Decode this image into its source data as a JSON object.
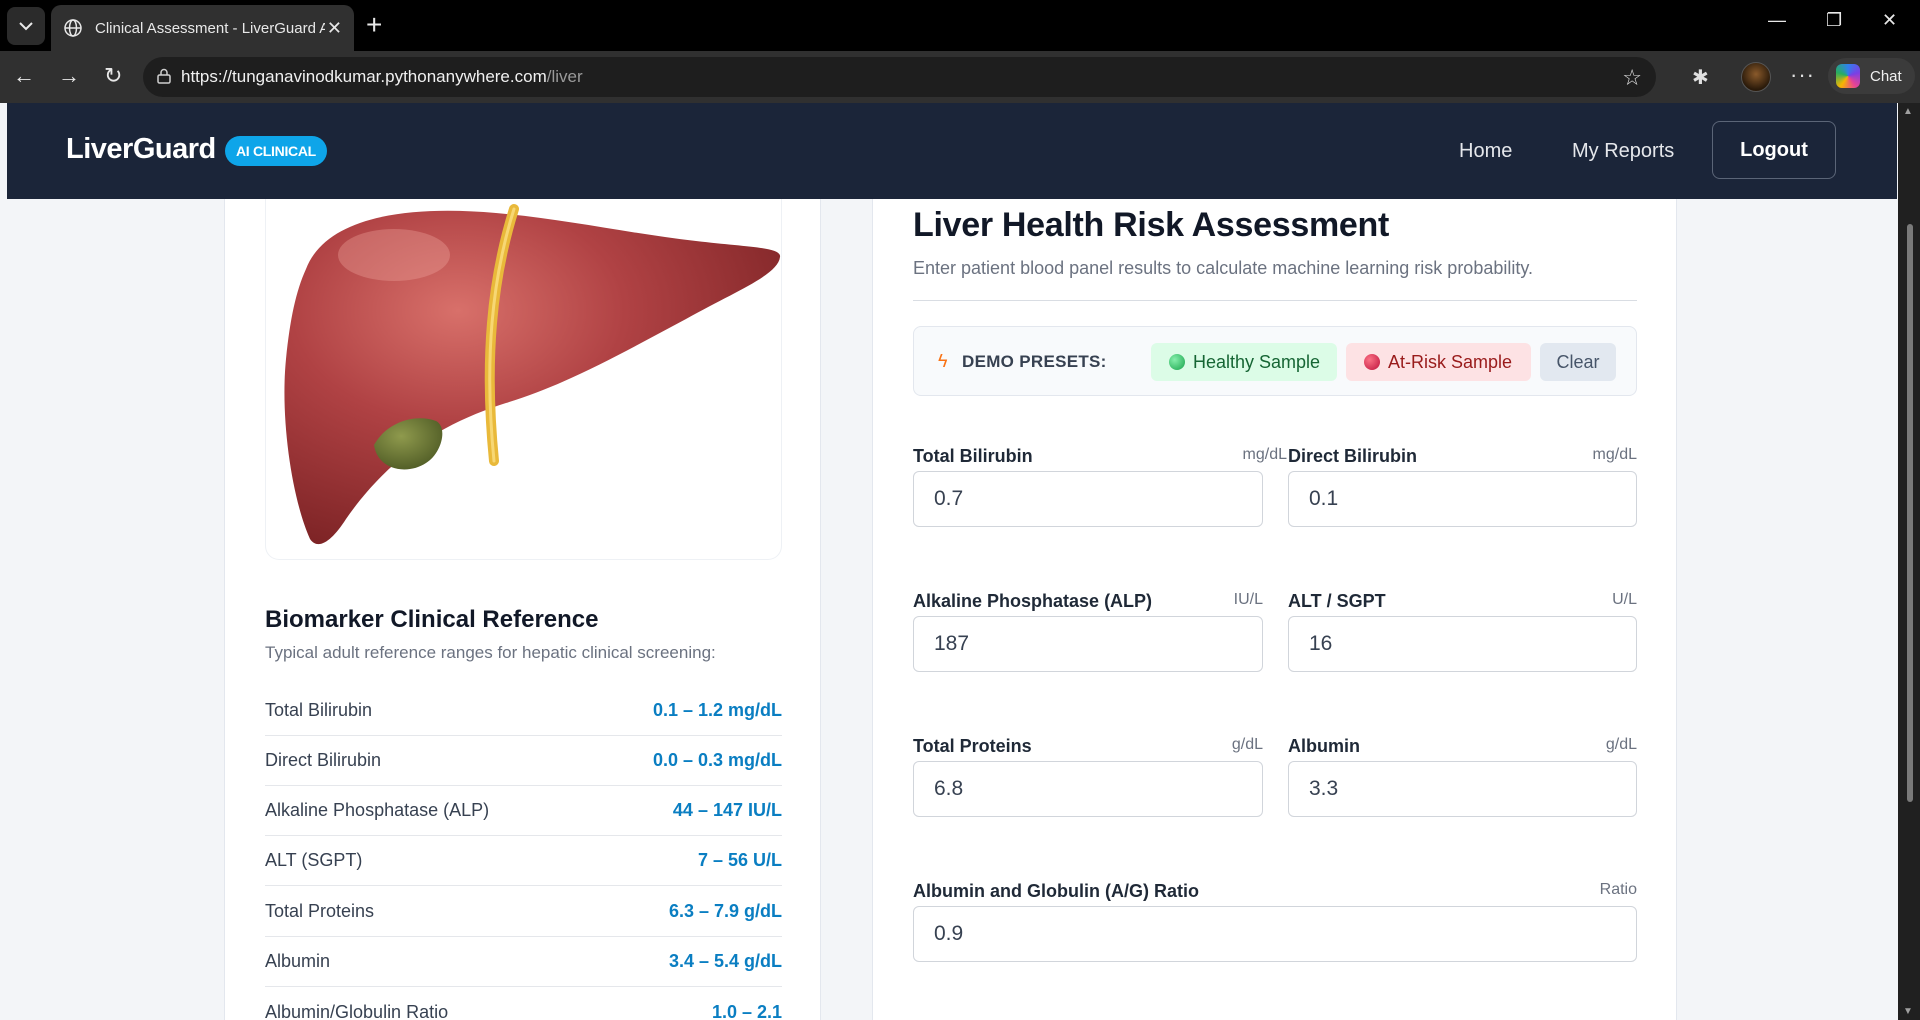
{
  "browser": {
    "tab_title": "Clinical Assessment - LiverGuard AI",
    "url_host": "https://tunganavinodkumar.pythonanywhere.com",
    "url_path": "/liver",
    "chat_label": "Chat"
  },
  "nav": {
    "brand": "LiverGuard",
    "badge": "AI CLINICAL",
    "home": "Home",
    "reports": "My Reports",
    "logout": "Logout"
  },
  "reference": {
    "title": "Biomarker Clinical Reference",
    "subtitle": "Typical adult reference ranges for hepatic clinical screening:",
    "rows": [
      {
        "name": "Total Bilirubin",
        "range": "0.1 – 1.2 mg/dL"
      },
      {
        "name": "Direct Bilirubin",
        "range": "0.0 – 0.3 mg/dL"
      },
      {
        "name": "Alkaline Phosphatase (ALP)",
        "range": "44 – 147 IU/L"
      },
      {
        "name": "ALT (SGPT)",
        "range": "7 – 56 U/L"
      },
      {
        "name": "Total Proteins",
        "range": "6.3 – 7.9 g/dL"
      },
      {
        "name": "Albumin",
        "range": "3.4 – 5.4 g/dL"
      },
      {
        "name": "Albumin/Globulin Ratio",
        "range": "1.0 – 2.1"
      }
    ]
  },
  "form": {
    "title": "Liver Health Risk Assessment",
    "subtitle": "Enter patient blood panel results to calculate machine learning risk probability.",
    "presets_label": "DEMO PRESETS:",
    "healthy": "Healthy Sample",
    "at_risk": "At-Risk Sample",
    "clear": "Clear",
    "fields": [
      {
        "label": "Total Bilirubin",
        "unit": "mg/dL",
        "value": "0.7"
      },
      {
        "label": "Direct Bilirubin",
        "unit": "mg/dL",
        "value": "0.1"
      },
      {
        "label": "Alkaline Phosphatase (ALP)",
        "unit": "IU/L",
        "value": "187"
      },
      {
        "label": "ALT / SGPT",
        "unit": "U/L",
        "value": "16"
      },
      {
        "label": "Total Proteins",
        "unit": "g/dL",
        "value": "6.8"
      },
      {
        "label": "Albumin",
        "unit": "g/dL",
        "value": "3.3"
      },
      {
        "label": "Albumin and Globulin (A/G) Ratio",
        "unit": "Ratio",
        "value": "0.9"
      }
    ]
  }
}
